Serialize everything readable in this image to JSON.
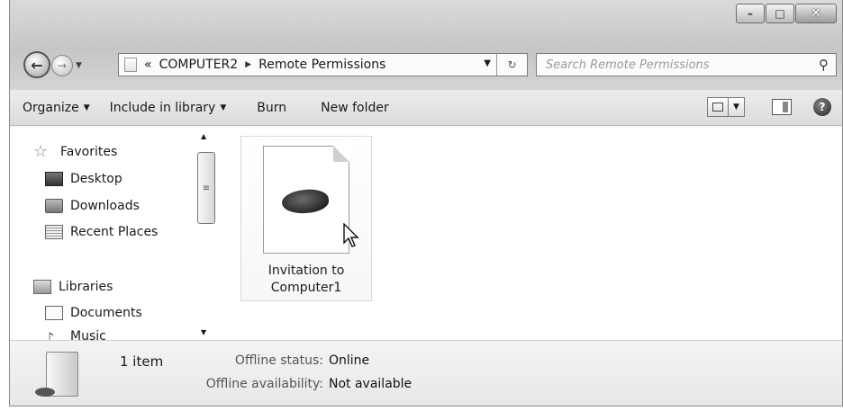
{
  "address": {
    "crumbs": [
      "COMPUTER2",
      "Remote Permissions"
    ],
    "prefix": "«"
  },
  "search": {
    "placeholder": "Search Remote Permissions"
  },
  "toolbar": {
    "organize": "Organize",
    "include_in_library": "Include in library",
    "burn": "Burn",
    "new_folder": "New folder"
  },
  "nav_pane": {
    "favorites": "Favorites",
    "desktop": "Desktop",
    "downloads": "Downloads",
    "recent_places": "Recent Places",
    "libraries": "Libraries",
    "documents": "Documents",
    "music": "Music"
  },
  "content": {
    "file": {
      "line1": "Invitation to",
      "line2": "Computer1"
    }
  },
  "details": {
    "item_count": "1 item",
    "offline_status_label": "Offline status:",
    "offline_status_value": "Online",
    "offline_availability_label": "Offline availability:",
    "offline_availability_value": "Not available"
  }
}
